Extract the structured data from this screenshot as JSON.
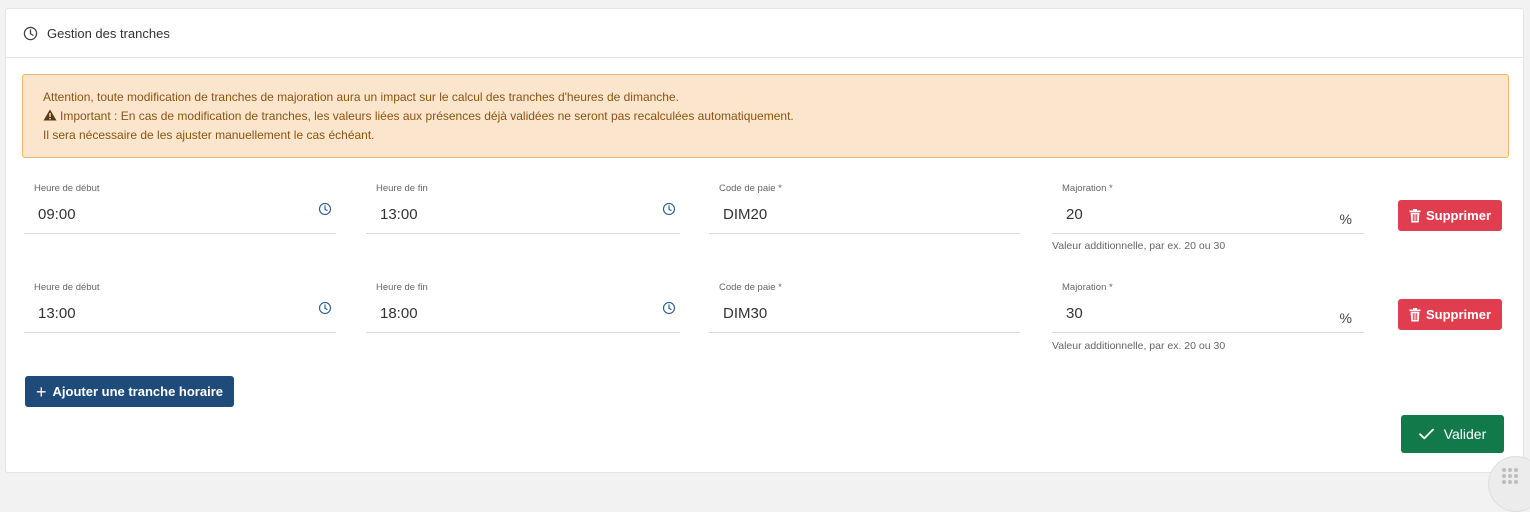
{
  "section": {
    "title": "Gestion des tranches",
    "icon": "clock-icon"
  },
  "alert": {
    "line1": "Attention, toute modification de tranches de majoration aura un impact sur le calcul des tranches d'heures de dimanche.",
    "line2": "Important : En cas de modification de tranches, les valeurs liées aux présences déjà validées ne seront pas recalculées automatiquement.",
    "line3": "Il sera nécessaire de les ajuster manuellement le cas échéant.",
    "icon": "warning-icon"
  },
  "labels": {
    "start": "Heure de début",
    "end": "Heure de fin",
    "pay_code": "Code de paie *",
    "markup": "Majoration *",
    "percent": "%",
    "helper": "Valeur additionnelle, par ex. 20 ou 30",
    "delete": "Supprimer"
  },
  "rows": [
    {
      "start": "09:00",
      "end": "13:00",
      "pay_code": "DIM20",
      "markup": "20"
    },
    {
      "start": "13:00",
      "end": "18:00",
      "pay_code": "DIM30",
      "markup": "30"
    }
  ],
  "actions": {
    "add_label": "Ajouter une tranche horaire",
    "validate_label": "Valider"
  },
  "colors": {
    "alert_bg": "#fbe5cd",
    "alert_border": "#f0b768",
    "alert_text": "#8a5510",
    "delete_btn": "#e03e4f",
    "add_btn": "#1f4b7a",
    "validate_btn": "#127a4a",
    "clock_icon": "#2a5d8f"
  }
}
